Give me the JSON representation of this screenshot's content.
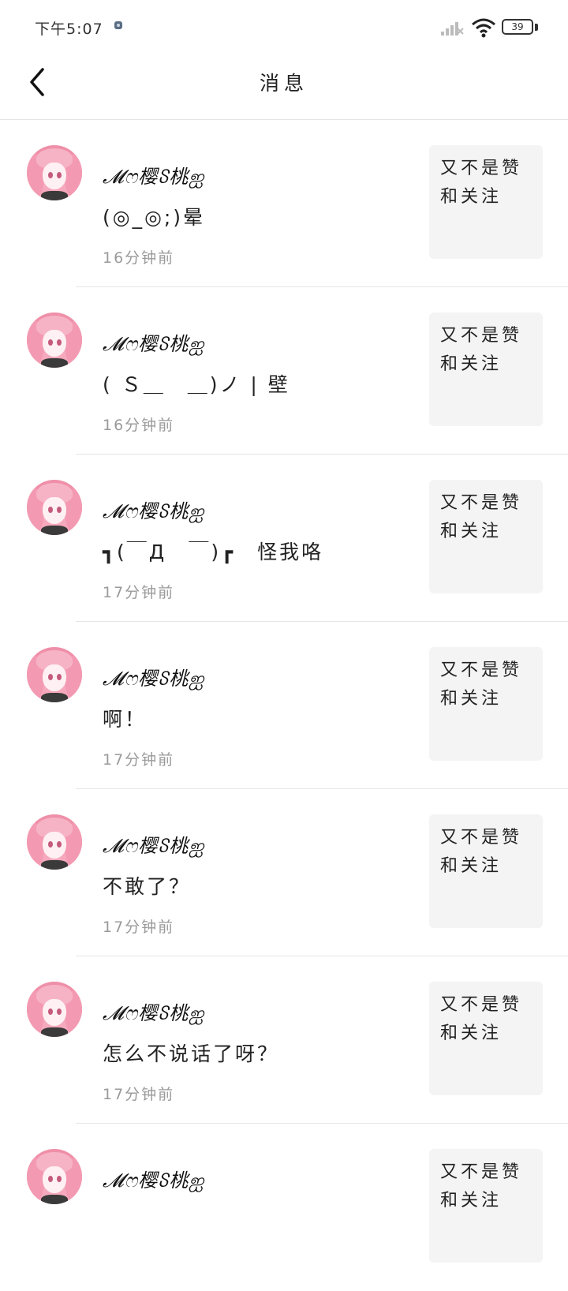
{
  "status_bar": {
    "time": "下午5:07",
    "battery": "39",
    "icons": [
      "notification-dot-icon",
      "signal-icon",
      "wifi-icon",
      "battery-icon"
    ]
  },
  "header": {
    "title": "消息",
    "back_icon": "back-chevron-icon"
  },
  "messages": [
    {
      "name": "𝓜ෆ樱ჽ桃ஐ",
      "text": "(◎_◎;)晕",
      "time": "16分钟前",
      "quote": "又不是赞和关注"
    },
    {
      "name": "𝓜ෆ樱ჽ桃ஐ",
      "text": "( Ｓ＿　＿)ノ | 壁",
      "time": "16分钟前",
      "quote": "又不是赞和关注"
    },
    {
      "name": "𝓜ෆ樱ჽ桃ஐ",
      "text": "┓(￣Д　￣)┏　怪我咯",
      "time": "17分钟前",
      "quote": "又不是赞和关注"
    },
    {
      "name": "𝓜ෆ樱ჽ桃ஐ",
      "text": "啊！",
      "time": "17分钟前",
      "quote": "又不是赞和关注"
    },
    {
      "name": "𝓜ෆ樱ჽ桃ஐ",
      "text": "不敢了？",
      "time": "17分钟前",
      "quote": "又不是赞和关注"
    },
    {
      "name": "𝓜ෆ樱ჽ桃ஐ",
      "text": "怎么不说话了呀？",
      "time": "17分钟前",
      "quote": "又不是赞和关注"
    },
    {
      "name": "𝓜ෆ樱ჽ桃ஐ",
      "text": "",
      "time": "",
      "quote": "又不是赞和关注"
    }
  ]
}
